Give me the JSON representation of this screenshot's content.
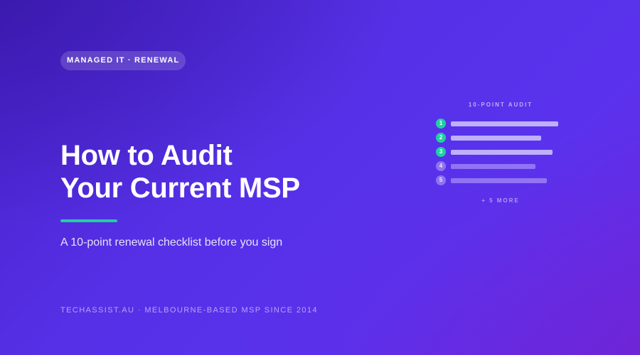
{
  "tag": "MANAGED IT · RENEWAL",
  "title_lines": [
    "How to Audit",
    "Your Current MSP"
  ],
  "subtitle": "A 10-point renewal checklist before you sign",
  "footer": "TECHASSIST.AU · MELBOURNE-BASED MSP SINCE 2014",
  "checklist": {
    "title": "10-POINT AUDIT",
    "items": [
      {
        "number": "1",
        "completed": true
      },
      {
        "number": "2",
        "completed": true
      },
      {
        "number": "3",
        "completed": true
      },
      {
        "number": "4",
        "completed": false
      },
      {
        "number": "5",
        "completed": false
      }
    ],
    "more_label": "+ 5 MORE"
  },
  "colors": {
    "background_start": "#4a1fc9",
    "background_end": "#6a28e0",
    "accent": "#1fd1a0",
    "text": "#ffffff"
  }
}
